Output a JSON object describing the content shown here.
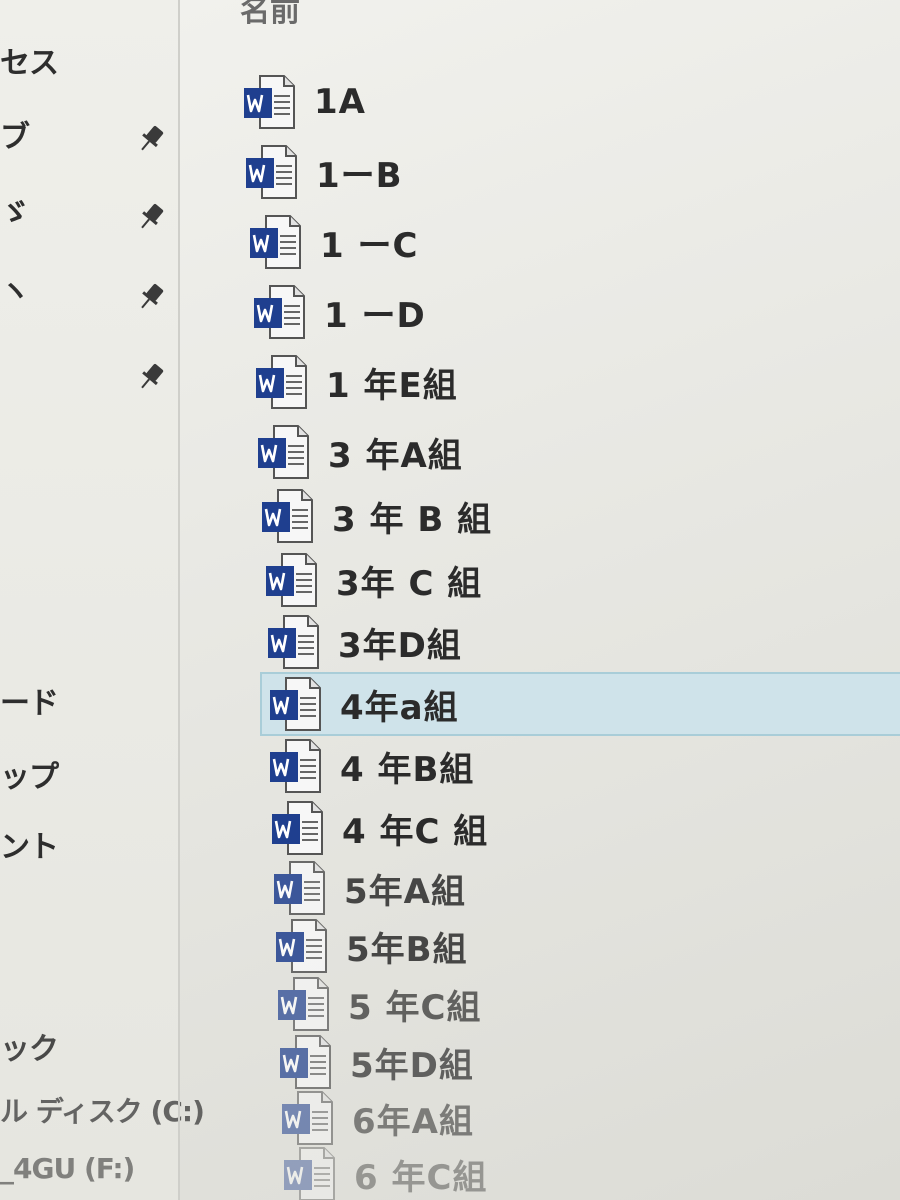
{
  "nav": {
    "items": [
      {
        "label": "セス",
        "pinned": false
      },
      {
        "label": "ブ",
        "pinned": true
      },
      {
        "label": "ゞ",
        "pinned": true
      },
      {
        "label": "ヽ",
        "pinned": true
      },
      {
        "label": "",
        "pinned": true
      },
      {
        "label": "ード",
        "pinned": false
      },
      {
        "label": "ップ",
        "pinned": false
      },
      {
        "label": "ント",
        "pinned": false
      },
      {
        "label": "ック",
        "pinned": false
      },
      {
        "label": "ル ディスク (C:)",
        "pinned": false
      },
      {
        "label": "_4GU (F:)",
        "pinned": false
      }
    ]
  },
  "list": {
    "header": "名前",
    "files": [
      {
        "name": "1A",
        "icon": "word-document-icon"
      },
      {
        "name": "1ーB",
        "icon": "word-document-icon"
      },
      {
        "name": "1 ーC",
        "icon": "word-document-icon"
      },
      {
        "name": "1 ーD",
        "icon": "word-document-icon"
      },
      {
        "name": "1 年E組",
        "icon": "word-document-icon"
      },
      {
        "name": "3 年A組",
        "icon": "word-document-icon"
      },
      {
        "name": " 3 年 B 組",
        "icon": "word-document-icon"
      },
      {
        "name": "3年 C 組",
        "icon": "word-document-icon"
      },
      {
        "name": "3年D組",
        "icon": "word-document-icon"
      },
      {
        "name": "4年a組",
        "icon": "word-document-icon",
        "selected": true
      },
      {
        "name": " 4 年B組",
        "icon": "word-document-icon"
      },
      {
        "name": " 4 年C 組",
        "icon": "word-document-icon"
      },
      {
        "name": "5年A組",
        "icon": "word-document-icon"
      },
      {
        "name": "5年B組",
        "icon": "word-document-icon"
      },
      {
        "name": " 5 年C組",
        "icon": "word-document-icon"
      },
      {
        "name": "5年D組",
        "icon": "word-document-icon"
      },
      {
        "name": "6年A組",
        "icon": "word-document-icon"
      },
      {
        "name": " 6 年C組",
        "icon": "word-document-icon"
      }
    ]
  },
  "colors": {
    "selection": "#cfe3ea",
    "word_blue": "#1f3f8f",
    "text": "#2b2b2b"
  }
}
